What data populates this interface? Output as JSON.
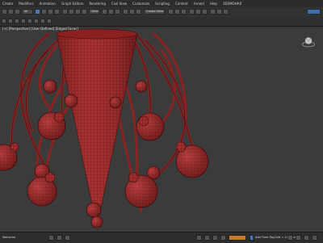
{
  "menu": [
    "Create",
    "Modifiers",
    "Animation",
    "Graph Editors",
    "Rendering",
    "Civil View",
    "Customize",
    "Scripting",
    "Content",
    "Arnold",
    "Help",
    "3DSMOHAX"
  ],
  "toolbar": {
    "selection_filter": "All",
    "view_dropdown": "View",
    "named_selection": "Create Selection Se"
  },
  "viewport": {
    "label": "[+] [Perspective] [User Defined] [Edged Faces]",
    "background": "#3b3b3b",
    "mesh_color": "#9e2a2a",
    "wire_color": "#3a0c0c"
  },
  "statusbar": {
    "left_text": "Welcome",
    "middle_text": "Add Time Tag",
    "coords": "Grid = 10,0mm"
  }
}
